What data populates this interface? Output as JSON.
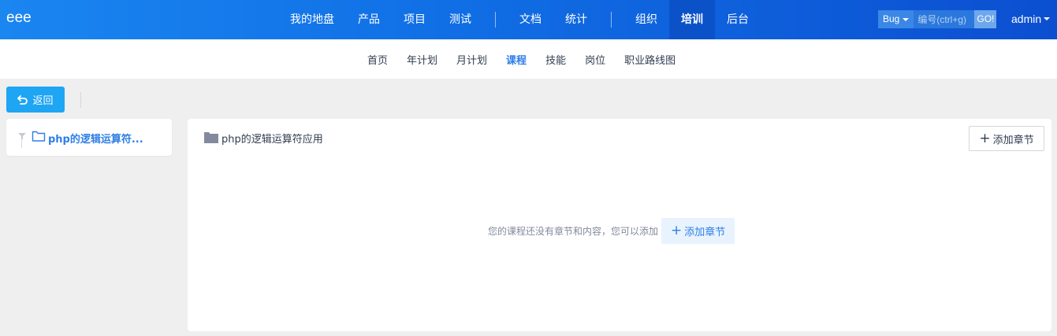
{
  "header": {
    "brand": "eee",
    "nav": [
      {
        "label": "我的地盘",
        "active": false
      },
      {
        "label": "产品",
        "active": false
      },
      {
        "label": "项目",
        "active": false
      },
      {
        "label": "测试",
        "active": false
      },
      {
        "label": "文档",
        "active": false
      },
      {
        "label": "统计",
        "active": false
      },
      {
        "label": "组织",
        "active": false
      },
      {
        "label": "培训",
        "active": true
      },
      {
        "label": "后台",
        "active": false
      }
    ],
    "search": {
      "type": "Bug",
      "placeholder": "编号(ctrl+g)",
      "go_label": "GO!"
    },
    "user": "admin"
  },
  "subnav": {
    "items": [
      {
        "label": "首页",
        "active": false
      },
      {
        "label": "年计划",
        "active": false
      },
      {
        "label": "月计划",
        "active": false
      },
      {
        "label": "课程",
        "active": true
      },
      {
        "label": "技能",
        "active": false
      },
      {
        "label": "岗位",
        "active": false
      },
      {
        "label": "职业路线图",
        "active": false
      }
    ]
  },
  "toolbar": {
    "back_label": "返回"
  },
  "tree": {
    "node_label": "php的逻辑运算符..."
  },
  "content": {
    "title": "php的逻辑运算符应用",
    "add_chapter_label": "添加章节",
    "empty_text": "您的课程还没有章节和内容，您可以添加",
    "empty_add_label": "添加章节"
  },
  "colors": {
    "header_start": "#1a86f0",
    "header_end": "#0b4fd0",
    "accent": "#2e7fe6",
    "back_button": "#1ea5f4"
  },
  "icons": {
    "back": "undo-arrow-icon",
    "tree_toggle": "funnel-icon",
    "tree_folder": "folder-outline-icon",
    "content_folder": "folder-filled-icon",
    "plus": "plus-icon"
  }
}
